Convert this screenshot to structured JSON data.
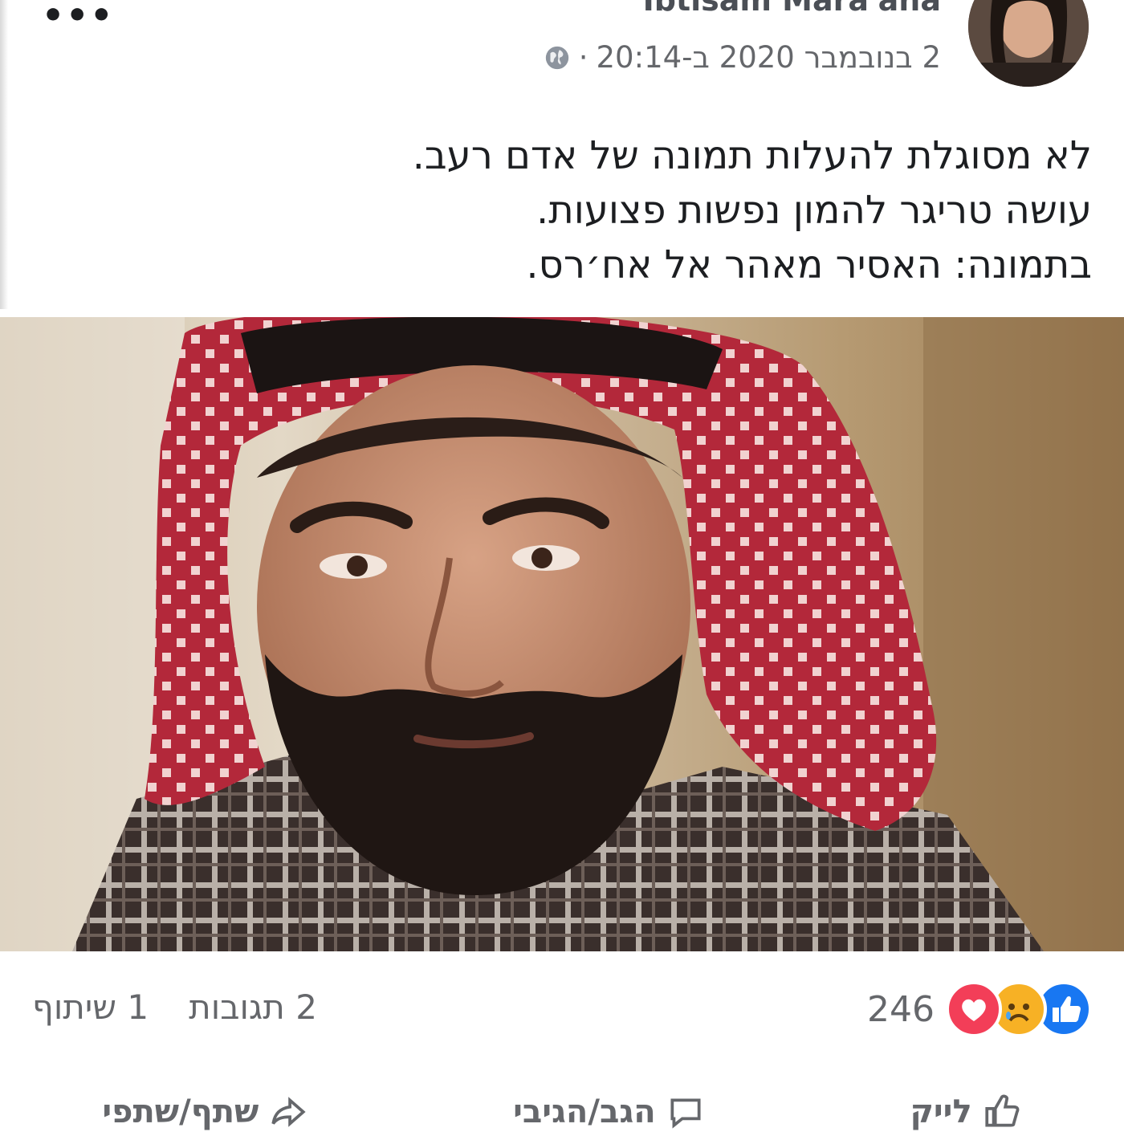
{
  "post": {
    "author": "Ibtisam Mara'ana",
    "timestamp": "2 בנובמבר 2020 ב-20:14",
    "separator": "·",
    "privacy_icon": "globe-icon",
    "more_label": "•••",
    "text_lines": [
      "לא מסוגלת להעלות תמונה של אדם רעב.",
      "עושה טריגר להמון נפשות פצועות.",
      "בתמונה: האסיר מאהר אל אח׳רס."
    ]
  },
  "reactions": {
    "icons": [
      "like-icon",
      "sad-icon",
      "love-icon"
    ],
    "count": "246",
    "colors": {
      "like": "#1877f2",
      "sad": "#f7b125",
      "love": "#f33e58"
    }
  },
  "stats": {
    "comments": "2 תגובות",
    "shares": "1 שיתוף"
  },
  "actions": {
    "like": "לייק",
    "comment": "הגב/הגיבי",
    "share": "שתף/שתפי"
  }
}
